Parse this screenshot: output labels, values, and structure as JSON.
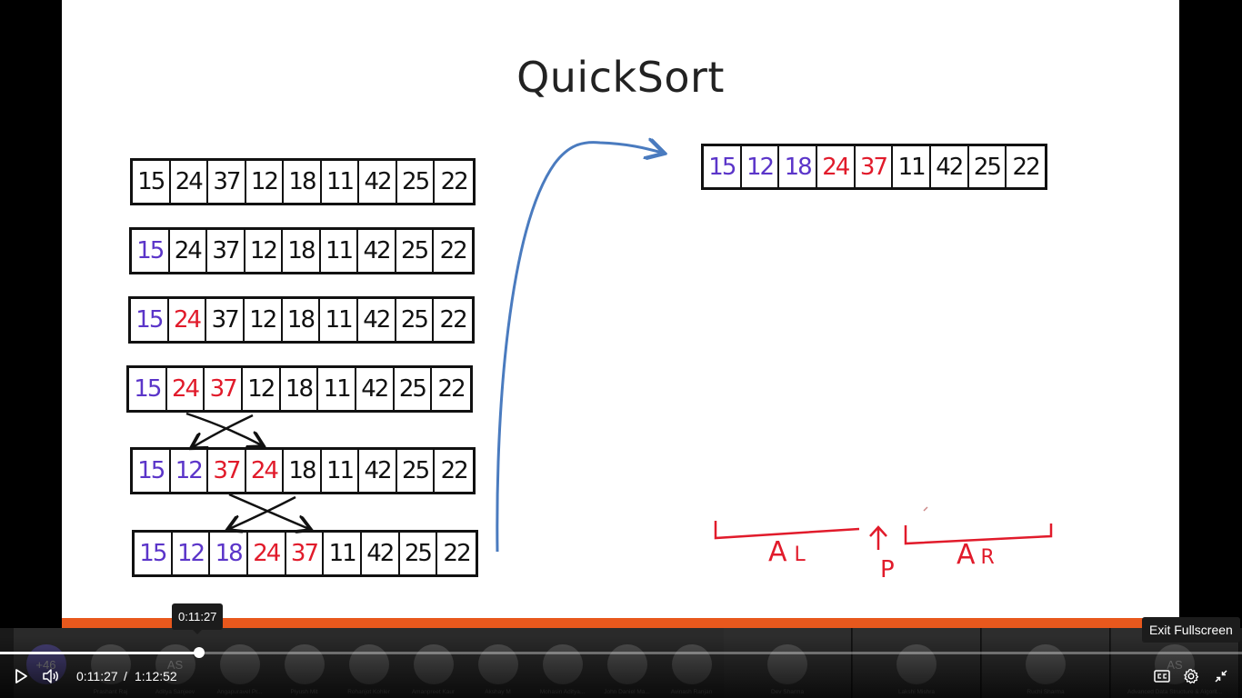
{
  "slide": {
    "title": "QuickSort",
    "left_arrays": [
      {
        "cells": [
          {
            "v": "15",
            "c": "black"
          },
          {
            "v": "24",
            "c": "black"
          },
          {
            "v": "37",
            "c": "black"
          },
          {
            "v": "12",
            "c": "black"
          },
          {
            "v": "18",
            "c": "black"
          },
          {
            "v": "11",
            "c": "black"
          },
          {
            "v": "42",
            "c": "black"
          },
          {
            "v": "25",
            "c": "black"
          },
          {
            "v": "22",
            "c": "black"
          }
        ]
      },
      {
        "cells": [
          {
            "v": "15",
            "c": "purple"
          },
          {
            "v": "24",
            "c": "black"
          },
          {
            "v": "37",
            "c": "black"
          },
          {
            "v": "12",
            "c": "black"
          },
          {
            "v": "18",
            "c": "black"
          },
          {
            "v": "11",
            "c": "black"
          },
          {
            "v": "42",
            "c": "black"
          },
          {
            "v": "25",
            "c": "black"
          },
          {
            "v": "22",
            "c": "black"
          }
        ]
      },
      {
        "cells": [
          {
            "v": "15",
            "c": "purple"
          },
          {
            "v": "24",
            "c": "red"
          },
          {
            "v": "37",
            "c": "black"
          },
          {
            "v": "12",
            "c": "black"
          },
          {
            "v": "18",
            "c": "black"
          },
          {
            "v": "11",
            "c": "black"
          },
          {
            "v": "42",
            "c": "black"
          },
          {
            "v": "25",
            "c": "black"
          },
          {
            "v": "22",
            "c": "black"
          }
        ]
      },
      {
        "cells": [
          {
            "v": "15",
            "c": "purple"
          },
          {
            "v": "24",
            "c": "red"
          },
          {
            "v": "37",
            "c": "red"
          },
          {
            "v": "12",
            "c": "black"
          },
          {
            "v": "18",
            "c": "black"
          },
          {
            "v": "11",
            "c": "black"
          },
          {
            "v": "42",
            "c": "black"
          },
          {
            "v": "25",
            "c": "black"
          },
          {
            "v": "22",
            "c": "black"
          }
        ]
      },
      {
        "cells": [
          {
            "v": "15",
            "c": "purple"
          },
          {
            "v": "12",
            "c": "purple"
          },
          {
            "v": "37",
            "c": "red"
          },
          {
            "v": "24",
            "c": "red"
          },
          {
            "v": "18",
            "c": "black"
          },
          {
            "v": "11",
            "c": "black"
          },
          {
            "v": "42",
            "c": "black"
          },
          {
            "v": "25",
            "c": "black"
          },
          {
            "v": "22",
            "c": "black"
          }
        ]
      },
      {
        "cells": [
          {
            "v": "15",
            "c": "purple"
          },
          {
            "v": "12",
            "c": "purple"
          },
          {
            "v": "18",
            "c": "purple"
          },
          {
            "v": "24",
            "c": "red"
          },
          {
            "v": "37",
            "c": "red"
          },
          {
            "v": "11",
            "c": "black"
          },
          {
            "v": "42",
            "c": "black"
          },
          {
            "v": "25",
            "c": "black"
          },
          {
            "v": "22",
            "c": "black"
          }
        ]
      }
    ],
    "right_array": {
      "cells": [
        {
          "v": "15",
          "c": "purple"
        },
        {
          "v": "12",
          "c": "purple"
        },
        {
          "v": "18",
          "c": "purple"
        },
        {
          "v": "24",
          "c": "red"
        },
        {
          "v": "37",
          "c": "red"
        },
        {
          "v": "11",
          "c": "black"
        },
        {
          "v": "42",
          "c": "black"
        },
        {
          "v": "25",
          "c": "black"
        },
        {
          "v": "22",
          "c": "black"
        }
      ]
    },
    "annotation": {
      "left_label": "A",
      "left_sub": "L",
      "pivot_label": "P",
      "right_label": "A",
      "right_sub": "R"
    },
    "colors": {
      "purple": "#5b35c9",
      "red": "#e11b2b",
      "black": "#111111",
      "accent_bar": "#e8581d",
      "arrow": "#4a7bbf"
    }
  },
  "participants": [
    {
      "initials": "+46",
      "name": ""
    },
    {
      "initials": "",
      "name": "Prashant Raj"
    },
    {
      "initials": "AS",
      "name": "Aditya Sanjeev"
    },
    {
      "initials": "",
      "name": "Angapuravel Pr..."
    },
    {
      "initials": "",
      "name": "Piyush Mit"
    },
    {
      "initials": "",
      "name": "Rohanjot Kohler"
    },
    {
      "initials": "",
      "name": "Amanpreet Kaur"
    },
    {
      "initials": "",
      "name": "Akshay M"
    },
    {
      "initials": "",
      "name": "Mohasin Aditya..."
    },
    {
      "initials": "",
      "name": "John Daniel Ma..."
    },
    {
      "initials": "",
      "name": "Avinash Ranjan"
    },
    {
      "initials": "",
      "name": "Dev Sharma"
    },
    {
      "initials": "",
      "name": "Lakshi Mishra"
    },
    {
      "initials": "",
      "name": "Ruchi Sharma"
    },
    {
      "initials": "AS",
      "name": "Advanced Data Structure & Algorit..."
    }
  ],
  "player": {
    "current_time": "0:11:27",
    "separator": "/",
    "duration": "1:12:52",
    "hover_time": "0:11:27",
    "progress_fraction": 0.16,
    "exit_fullscreen_tooltip": "Exit Fullscreen",
    "icons": {
      "play": "play-icon",
      "volume": "volume-icon",
      "captions": "captions-icon",
      "settings": "gear-icon",
      "exit_fullscreen": "exit-fullscreen-icon"
    }
  }
}
